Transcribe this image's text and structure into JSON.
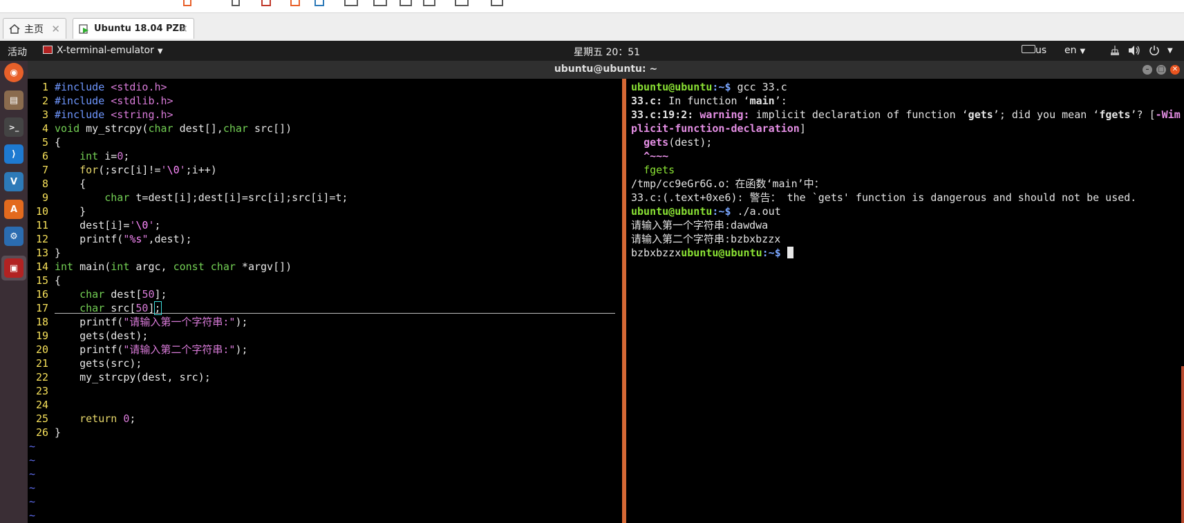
{
  "tabs": [
    {
      "label": "主页",
      "icon": "home-icon",
      "active": false
    },
    {
      "label": "Ubuntu 18.04 PZB",
      "icon": "vm-play-icon",
      "active": true
    }
  ],
  "topbar": {
    "activities": "活动",
    "app_menu": "X-terminal-emulator",
    "clock": "星期五 20：51",
    "keyboard": "us",
    "language": "en"
  },
  "terminal": {
    "title": "ubuntu@ubuntu: ~",
    "accent": "#d56835"
  },
  "dock": [
    {
      "name": "firefox-icon",
      "color": "#e8602a",
      "glyph": "◉"
    },
    {
      "name": "files-icon",
      "color": "#8a6b4e",
      "glyph": "▤"
    },
    {
      "name": "terminal-icon",
      "color": "#444444",
      "glyph": ">_"
    },
    {
      "name": "vscode-icon",
      "color": "#1e7ad1",
      "glyph": "⟩"
    },
    {
      "name": "vc-app-icon",
      "color": "#2d7ab8",
      "glyph": "V"
    },
    {
      "name": "software-center-icon",
      "color": "#e36a1e",
      "glyph": "A"
    },
    {
      "name": "network-tool-icon",
      "color": "#2b6cb0",
      "glyph": "⚙"
    },
    {
      "name": "terminal-emulator-icon",
      "color": "#b22222",
      "glyph": "▣"
    }
  ],
  "vim": {
    "line_numbers": [
      "1",
      "2",
      "3",
      "4",
      "5",
      "6",
      "7",
      "8",
      "9",
      "10",
      "11",
      "12",
      "13",
      "14",
      "15",
      "16",
      "17",
      "18",
      "19",
      "20",
      "21",
      "22",
      "23",
      "24",
      "25",
      "26"
    ],
    "tilde": "~"
  },
  "shell": {
    "prompt_user": "ubuntu@ubuntu",
    "prompt_path": ":~$ ",
    "cmd1": "gcc 33.c",
    "cmd2": "./a.out",
    "out_infunc_file": "33.c:",
    "out_infunc_text": " In function ‘",
    "out_infunc_name": "main",
    "out_infunc_end": "’:",
    "warn_loc": "33.c:19:2:",
    "warn_label": " warning:",
    "warn_text1": " implicit declaration of function ‘",
    "warn_fn": "gets",
    "warn_text2": "’; did you mean ‘",
    "warn_sugg": "fgets",
    "warn_text3": "’? [",
    "warn_flag1": "-Wim",
    "warn_flag2": "plicit-function-declaration",
    "warn_close": "]",
    "src_gets": "gets",
    "src_rest": "(dest);",
    "src_caret": "^~~~",
    "src_fix": "fgets",
    "link1": "/tmp/cc9eGr6G.o：在函数‘main’中：",
    "link2": "33.c:(.text+0xe6): 警告： the `gets' function is dangerous and should not be used.",
    "input1": "请输入第一个字符串:dawdwa",
    "input2": "请输入第二个字符串:bzbxbzzx",
    "output": "bzbxbzzx"
  }
}
